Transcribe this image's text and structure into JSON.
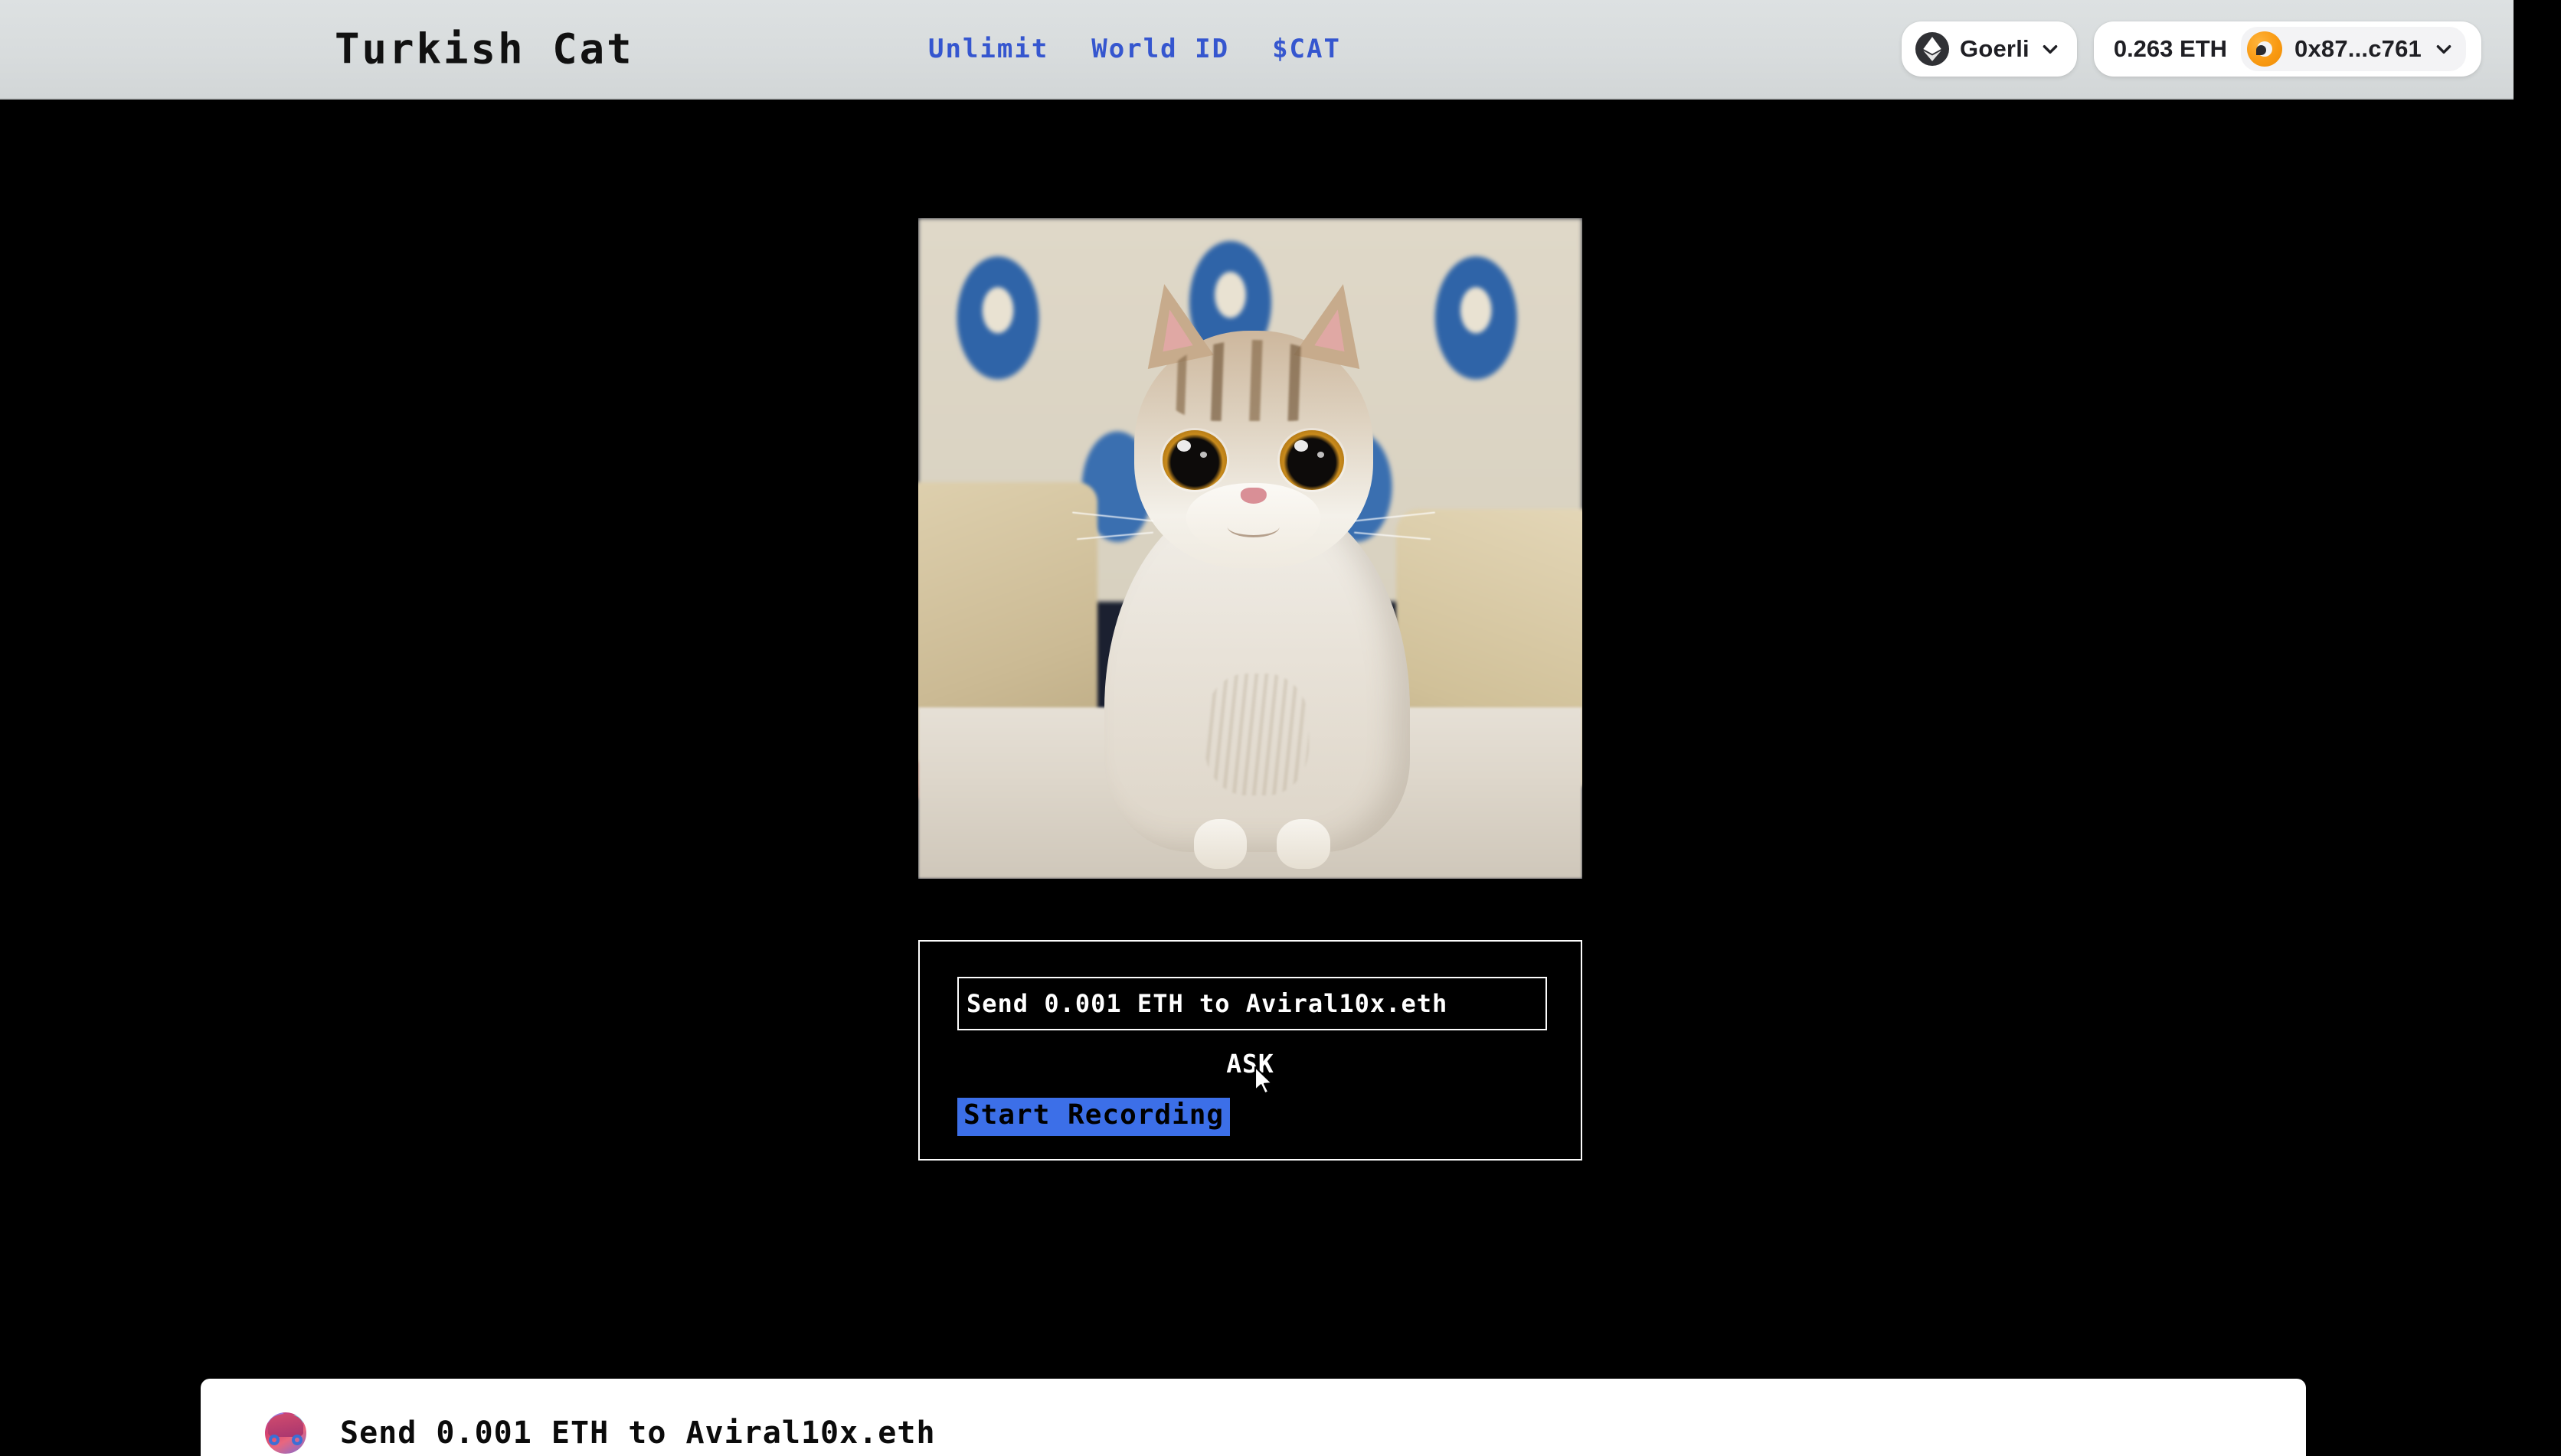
{
  "header": {
    "brand": "Turkish Cat",
    "nav": [
      {
        "label": "Unlimit"
      },
      {
        "label": "World ID"
      },
      {
        "label": "$CAT"
      }
    ],
    "wallet": {
      "network_label": "Goerli",
      "network_icon": "ethereum-icon",
      "network_chevron": "chevron-down-icon",
      "balance": "0.263 ETH",
      "address": "0x87...c761",
      "account_avatar": "account-avatar-icon",
      "account_chevron": "chevron-down-icon"
    },
    "colors": {
      "background": "#d8dcdd",
      "nav_link": "#3556cf",
      "brand_text": "#111111"
    }
  },
  "main": {
    "hero_image_alt": "turkish-cat-illustration",
    "form": {
      "input_value": "Send 0.001 ETH to Aviral10x.eth",
      "input_placeholder": "Send 0.001 ETH to Aviral10x.eth",
      "ask_label": "ASK",
      "record_label": "Start Recording",
      "record_bg": "#3c6fe8",
      "panel_bg": "#000000",
      "border_color": "#fdfdfd"
    },
    "cursor": "mouse-pointer"
  },
  "bottom_card": {
    "message": "Send 0.001 ETH to Aviral10x.eth",
    "avatar": "user-avatar-icon",
    "background": "#ffffff"
  }
}
